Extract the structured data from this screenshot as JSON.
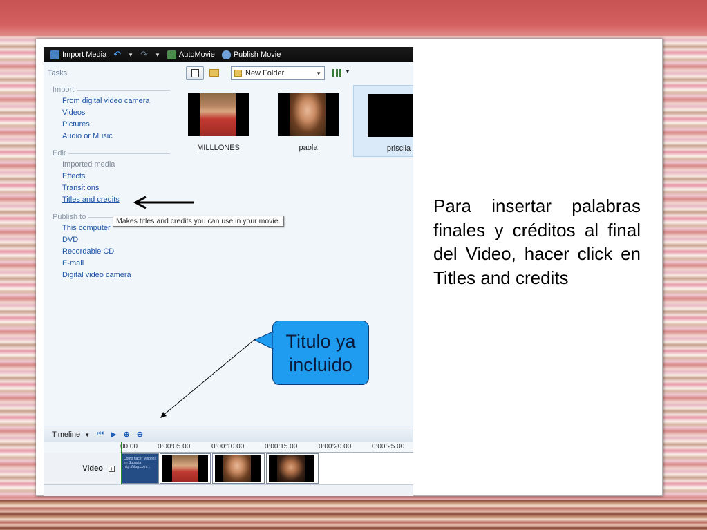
{
  "toolbar": {
    "import_media": "Import Media",
    "automovie": "AutoMovie",
    "publish_movie": "Publish Movie"
  },
  "tasks": {
    "title": "Tasks",
    "import": {
      "heading": "Import",
      "items": [
        "From digital video camera",
        "Videos",
        "Pictures",
        "Audio or Music"
      ]
    },
    "edit": {
      "heading": "Edit",
      "items": [
        "Imported media",
        "Effects",
        "Transitions",
        "Titles and credits"
      ]
    },
    "publish": {
      "heading": "Publish to",
      "items": [
        "This computer",
        "DVD",
        "Recordable CD",
        "E-mail",
        "Digital video camera"
      ]
    }
  },
  "tooltip": "Makes titles and credits you can use in your movie.",
  "content": {
    "folder": "New Folder",
    "thumbnails": [
      {
        "name": "MILLLONES",
        "selected": false
      },
      {
        "name": "paola",
        "selected": false
      },
      {
        "name": "priscila",
        "selected": true
      }
    ]
  },
  "timeline": {
    "label": "Timeline",
    "ruler": [
      "00.00",
      "0:00:05.00",
      "0:00:10.00",
      "0:00:15.00",
      "0:00:20.00",
      "0:00:25.00"
    ],
    "track_label": "Video",
    "title_clip_text": "Como hacer Millones en Subasta http://blog.com/..."
  },
  "slide": {
    "caption": "Para insertar palabras finales y créditos al final del Video, hacer click en Titles and credits",
    "bubble": "Titulo ya incluido"
  },
  "colors": {
    "accent_link": "#1f55a8",
    "bubble": "#1f9cf0",
    "top_band": "#c75353"
  }
}
